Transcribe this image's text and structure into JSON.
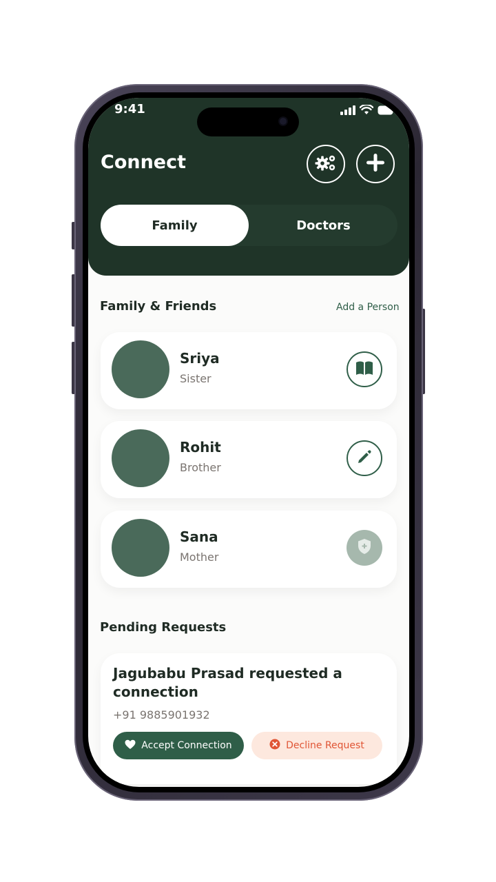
{
  "status_bar": {
    "time": "9:41"
  },
  "header": {
    "title": "Connect"
  },
  "tabs": [
    {
      "label": "Family"
    },
    {
      "label": "Doctors"
    }
  ],
  "family_section": {
    "title": "Family & Friends",
    "add_label": "Add a Person",
    "people": [
      {
        "name": "Sriya",
        "relation": "Sister",
        "action_icon": "book-icon"
      },
      {
        "name": "Rohit",
        "relation": "Brother",
        "action_icon": "pencil-icon"
      },
      {
        "name": "Sana",
        "relation": "Mother",
        "action_icon": "shield-icon"
      }
    ]
  },
  "pending_section": {
    "title": "Pending Requests",
    "request": {
      "message": "Jagubabu Prasad requested a connection",
      "phone": "+91 9885901932",
      "accept_label": "Accept Connection",
      "decline_label": "Decline Request"
    }
  },
  "colors": {
    "primary": "#1f3428",
    "accent": "#2f5e48",
    "decline": "#e05535"
  }
}
